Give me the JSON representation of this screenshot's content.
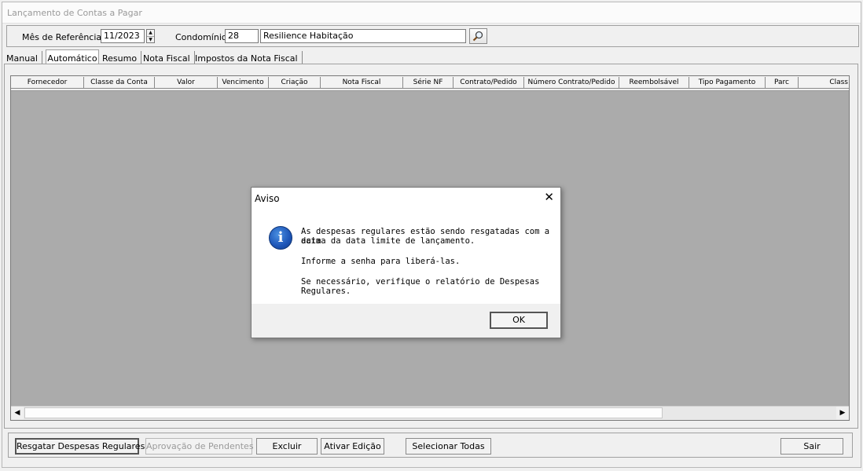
{
  "window": {
    "title": "Lançamento de Contas a Pagar"
  },
  "filter": {
    "mes_label": "Mês de Referência:",
    "mes_value": "11/2023",
    "condominio_label": "Condomínio:",
    "condominio_code": "28",
    "condominio_name": "Resilience Habitação"
  },
  "tabs": [
    "Manual",
    "Automático",
    "Resumo",
    "Nota Fiscal",
    "Impostos da Nota Fiscal"
  ],
  "grid": {
    "columns": [
      "Fornecedor",
      "Classe da Conta",
      "Valor",
      "Vencimento",
      "Criação",
      "Nota Fiscal",
      "Série NF",
      "Contrato/Pedido",
      "Número Contrato/Pedido",
      "Reembolsável",
      "Tipo Pagamento",
      "Parc",
      "Class"
    ]
  },
  "buttons": {
    "resgatar": "Resgatar Despesas Regulares",
    "aprovacao": "Aprovação de Pendentes",
    "excluir": "Excluir",
    "ativar": "Ativar Edição",
    "selecionar": "Selecionar Todas",
    "sair": "Sair"
  },
  "dialog": {
    "title": "Aviso",
    "line1": "As despesas regulares estão sendo resgatadas com a data",
    "line2": "acima da data limite de lançamento.",
    "line3": "Informe a senha para liberá-las.",
    "line4": "Se necessário, verifique o relatório de Despesas Regulares.",
    "ok": "OK"
  }
}
